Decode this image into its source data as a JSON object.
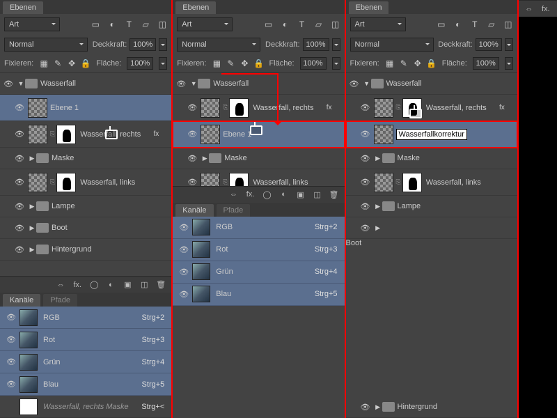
{
  "tabs": {
    "layers": "Ebenen",
    "channels": "Kanäle",
    "paths": "Pfade"
  },
  "filter": {
    "label": "Art"
  },
  "blend": {
    "mode": "Normal",
    "opacity_label": "Deckkraft:",
    "opacity": "100%"
  },
  "lock": {
    "label": "Fixieren:",
    "fill_label": "Fläche:",
    "fill": "100%"
  },
  "layers": {
    "wasserfall": "Wasserfall",
    "ebene1": "Ebene 1",
    "w_rechts": "Wasserfall, rechts",
    "maske": "Maske",
    "w_links": "Wasserfall, links",
    "lampe": "Lampe",
    "boot": "Boot",
    "hintergrund": "Hintergrund",
    "rename_value": "Wasserfallkorrektur"
  },
  "fx": "fx",
  "channels": [
    {
      "name": "RGB",
      "shortcut": "Strg+2"
    },
    {
      "name": "Rot",
      "shortcut": "Strg+3"
    },
    {
      "name": "Grün",
      "shortcut": "Strg+4"
    },
    {
      "name": "Blau",
      "shortcut": "Strg+5"
    }
  ],
  "mask_channel": {
    "name": "Wasserfall, rechts Maske",
    "shortcut": "Strg+<"
  }
}
